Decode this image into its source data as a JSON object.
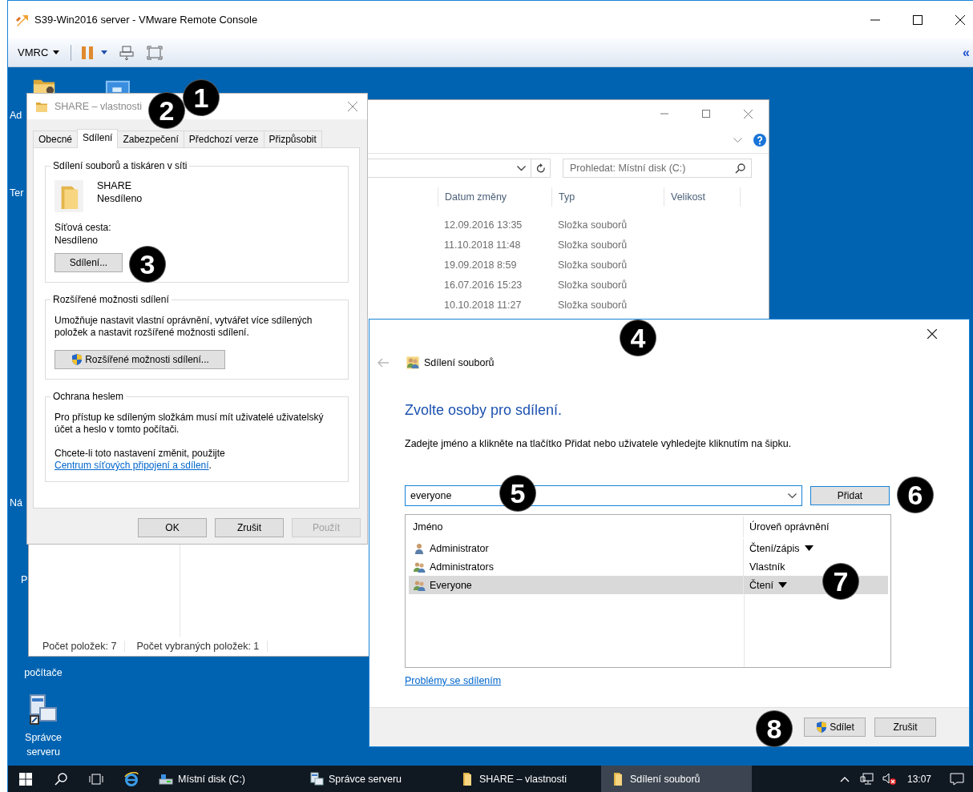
{
  "app_window": {
    "title": "S39-Win2016 server - VMware Remote Console",
    "menu_label": "VMRC",
    "collapse_glyph": "«"
  },
  "desktop_icons": [
    {
      "label": "Ad",
      "kind": "cut"
    },
    {
      "label": "Ter",
      "kind": "cut"
    },
    {
      "label": "Ná",
      "kind": "cut"
    },
    {
      "label": "P",
      "kind": "cut"
    },
    {
      "label": "počítače",
      "kind": "label"
    },
    {
      "label": "Správce serveru",
      "kind": "server"
    }
  ],
  "explorer": {
    "search_placeholder": "Prohledat: Místní disk (C:)",
    "columns": [
      "Datum změny",
      "Typ",
      "Velikost"
    ],
    "rows": [
      {
        "date": "12.09.2016 13:35",
        "type": "Složka souborů"
      },
      {
        "date": "11.10.2018 11:48",
        "type": "Složka souborů"
      },
      {
        "date": "19.09.2018 8:59",
        "type": "Složka souborů"
      },
      {
        "date": "16.07.2016 15:23",
        "type": "Složka souborů"
      },
      {
        "date": "10.10.2018 11:27",
        "type": "Složka souborů"
      }
    ],
    "status": [
      "Počet položek: 7",
      "Počet vybraných položek: 1"
    ]
  },
  "properties": {
    "title": "SHARE – vlastnosti",
    "tabs": [
      {
        "label": "Obecné",
        "selected": false
      },
      {
        "label": "Sdílení",
        "selected": true
      },
      {
        "label": "Zabezpečení",
        "selected": false
      },
      {
        "label": "Předchozí verze",
        "selected": false
      },
      {
        "label": "Přizpůsobit",
        "selected": false
      }
    ],
    "sharing_group": {
      "title": "Sdílení souborů a tiskáren v síti",
      "folder_name": "SHARE",
      "folder_status": "Nesdíleno",
      "path_label": "Síťová cesta:",
      "path_value": "Nesdíleno",
      "button": "Sdílení..."
    },
    "advanced_group": {
      "title": "Rozšířené možnosti sdílení",
      "text": "Umožňuje nastavit vlastní oprávnění, vytvářet více sdílených položek a nastavit rozšířené možnosti sdílení.",
      "button": "Rozšířené možnosti sdílení..."
    },
    "password_group": {
      "title": "Ochrana heslem",
      "text": "Pro přístup ke sdíleným složkám musí mít uživatelé uživatelský účet a heslo v tomto počítači.",
      "link_intro": "Chcete-li toto nastavení změnit, použijte",
      "link": "Centrum síťových připojení a sdílení",
      "link_end": "."
    },
    "buttons": [
      {
        "label": "OK",
        "disabled": false
      },
      {
        "label": "Zrušit",
        "disabled": false
      },
      {
        "label": "Použít",
        "disabled": true
      }
    ]
  },
  "share_dialog": {
    "back_disabled": true,
    "title": "Sdílení souborů",
    "heading": "Zvolte osoby pro sdílení.",
    "instruction": "Zadejte jméno a klikněte na tlačítko Přidat nebo uživatele vyhledejte kliknutím na šipku.",
    "name_value": "everyone",
    "add_button": "Přidat",
    "columns": [
      "Jméno",
      "Úroveň oprávnění"
    ],
    "people": [
      {
        "name": "Administrator",
        "kind": "user",
        "permission": "Čtení/zápis",
        "editable": true,
        "selected": false
      },
      {
        "name": "Administrators",
        "kind": "group",
        "permission": "Vlastník",
        "editable": false,
        "selected": false
      },
      {
        "name": "Everyone",
        "kind": "group",
        "permission": "Čtení",
        "editable": true,
        "selected": true
      }
    ],
    "help_link": "Problémy se sdílením",
    "buttons": [
      {
        "label": "Sdílet",
        "shield": true
      },
      {
        "label": "Zrušit",
        "shield": false
      }
    ]
  },
  "taskbar": {
    "items": [
      {
        "label": "Místní disk (C:)",
        "kind": "drive",
        "selected": false
      },
      {
        "label": "Správce serveru",
        "kind": "server",
        "selected": false
      },
      {
        "label": "SHARE – vlastnosti",
        "kind": "folder",
        "selected": false
      },
      {
        "label": "Sdílení souborů",
        "kind": "folder",
        "selected": true
      }
    ],
    "clock": "13:07"
  },
  "badges": [
    "1",
    "2",
    "3",
    "4",
    "5",
    "6",
    "7",
    "8"
  ]
}
